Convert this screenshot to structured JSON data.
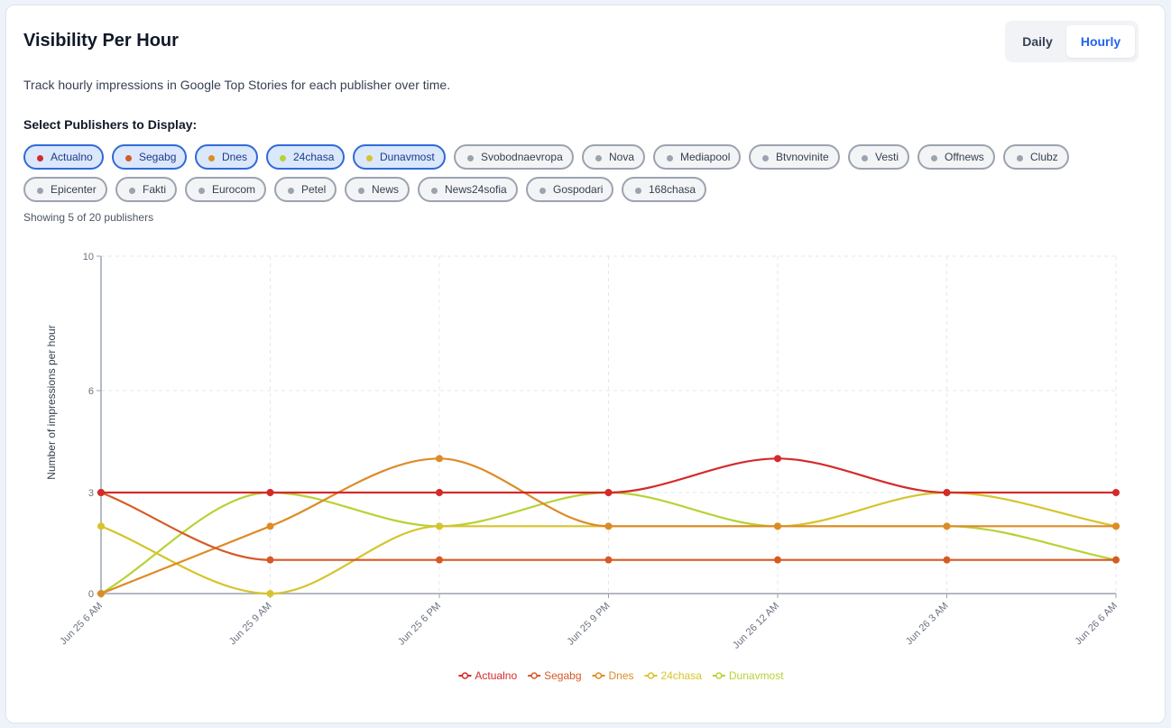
{
  "header": {
    "title": "Visibility Per Hour",
    "subtitle": "Track hourly impressions in Google Top Stories for each publisher over time.",
    "toggle": {
      "daily_label": "Daily",
      "hourly_label": "Hourly",
      "active": "Hourly"
    }
  },
  "publisher_select": {
    "label": "Select Publishers to Display:",
    "showing_text": "Showing 5 of 20 publishers",
    "chips": [
      {
        "label": "Actualno",
        "selected": true,
        "color": "#d42a2a"
      },
      {
        "label": "Segabg",
        "selected": true,
        "color": "#d65a25"
      },
      {
        "label": "Dnes",
        "selected": true,
        "color": "#dd8b27"
      },
      {
        "label": "24chasa",
        "selected": true,
        "color": "#b8d236"
      },
      {
        "label": "Dunavmost",
        "selected": true,
        "color": "#d6c42c"
      },
      {
        "label": "Svobodnaevropa",
        "selected": false,
        "color": "#9ca3af"
      },
      {
        "label": "Nova",
        "selected": false,
        "color": "#9ca3af"
      },
      {
        "label": "Mediapool",
        "selected": false,
        "color": "#9ca3af"
      },
      {
        "label": "Btvnovinite",
        "selected": false,
        "color": "#9ca3af"
      },
      {
        "label": "Vesti",
        "selected": false,
        "color": "#9ca3af"
      },
      {
        "label": "Offnews",
        "selected": false,
        "color": "#9ca3af"
      },
      {
        "label": "Clubz",
        "selected": false,
        "color": "#9ca3af"
      },
      {
        "label": "Epicenter",
        "selected": false,
        "color": "#9ca3af"
      },
      {
        "label": "Fakti",
        "selected": false,
        "color": "#9ca3af"
      },
      {
        "label": "Eurocom",
        "selected": false,
        "color": "#9ca3af"
      },
      {
        "label": "Petel",
        "selected": false,
        "color": "#9ca3af"
      },
      {
        "label": "News",
        "selected": false,
        "color": "#9ca3af"
      },
      {
        "label": "News24sofia",
        "selected": false,
        "color": "#9ca3af"
      },
      {
        "label": "Gospodari",
        "selected": false,
        "color": "#9ca3af"
      },
      {
        "label": "168chasa",
        "selected": false,
        "color": "#9ca3af"
      }
    ]
  },
  "chart_data": {
    "type": "line",
    "title": "",
    "xlabel": "",
    "ylabel": "Number of impressions per hour",
    "categories": [
      "Jun 25 6 AM",
      "Jun 25 9 AM",
      "Jun 25 6 PM",
      "Jun 25 9 PM",
      "Jun 26 12 AM",
      "Jun 26 3 AM",
      "Jun 26 6 AM"
    ],
    "y_ticks": [
      0,
      3,
      6,
      10
    ],
    "ylim": [
      0,
      10
    ],
    "grid": true,
    "legend_position": "bottom",
    "series": [
      {
        "name": "Actualno",
        "color": "#d42a2a",
        "values": [
          3,
          3,
          3,
          3,
          4,
          3,
          3
        ]
      },
      {
        "name": "Segabg",
        "color": "#d65a25",
        "values": [
          3,
          1,
          1,
          1,
          1,
          1,
          1
        ]
      },
      {
        "name": "Dnes",
        "color": "#dd8b27",
        "values": [
          0,
          2,
          4,
          2,
          2,
          2,
          2
        ]
      },
      {
        "name": "24chasa",
        "color": "#d6c42c",
        "values": [
          2,
          0,
          2,
          2,
          2,
          3,
          2
        ]
      },
      {
        "name": "Dunavmost",
        "color": "#b8d236",
        "values": [
          0,
          3,
          2,
          3,
          2,
          2,
          1
        ]
      }
    ]
  }
}
